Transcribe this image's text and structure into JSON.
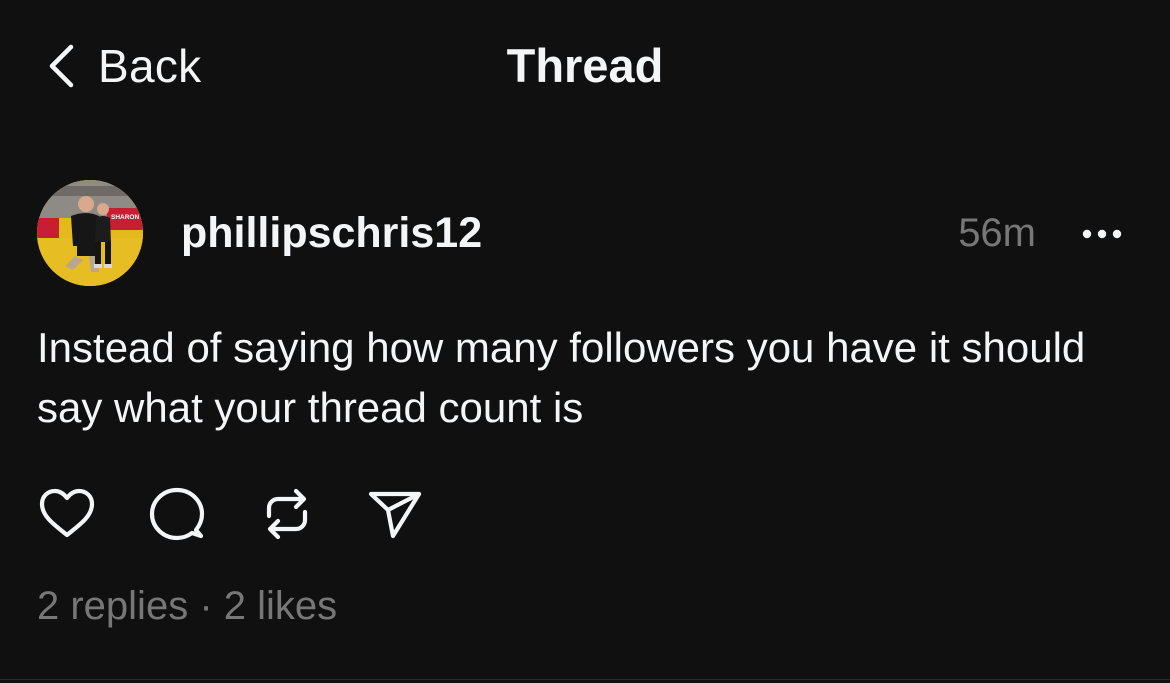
{
  "nav": {
    "back_label": "Back",
    "title": "Thread"
  },
  "post": {
    "username": "phillipschris12",
    "timestamp": "56m",
    "text": "Instead of saying how many followers you have it should say what your thread count is",
    "stats": {
      "replies": "2 replies",
      "separator": " · ",
      "likes": "2 likes"
    },
    "avatar_banner_text": "SHARON",
    "icons": {
      "back": "chevron-left-icon",
      "more": "more-horizontal-icon",
      "like": "heart-icon",
      "reply": "comment-bubble-icon",
      "repost": "repost-icon",
      "share": "send-icon"
    }
  },
  "colors": {
    "background": "#101010",
    "primary_text": "#f3f5f7",
    "secondary_text": "#777777"
  }
}
